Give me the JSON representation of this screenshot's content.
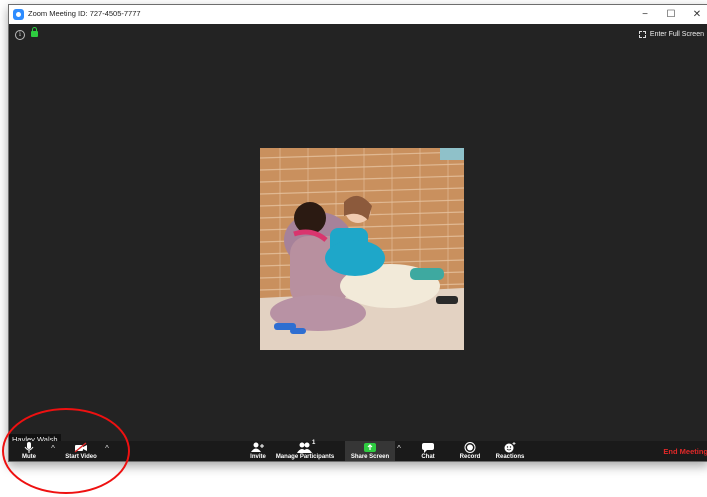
{
  "window": {
    "title": "Zoom Meeting ID: 727-4505-7777",
    "minimize": "−",
    "maximize": "☐",
    "close": "✕"
  },
  "stage": {
    "info_glyph": "i",
    "full_screen_label": "Enter Full Screen"
  },
  "participant": {
    "name": "Hayley Walsh"
  },
  "toolbar": {
    "mute": "Mute",
    "start_video": "Start Video",
    "invite": "Invite",
    "manage_participants": "Manage Participants",
    "participant_count": "1",
    "share_screen": "Share Screen",
    "chat": "Chat",
    "record": "Record",
    "reactions": "Reactions",
    "end_meeting": "End Meeting",
    "caret": "^"
  },
  "colors": {
    "stage_bg": "#232323",
    "toolbar_bg": "#1a1a1a",
    "share_green": "#2ecc40",
    "end_red": "#e02828",
    "annotation_red": "#e11111",
    "zoom_blue": "#2d8cff"
  }
}
